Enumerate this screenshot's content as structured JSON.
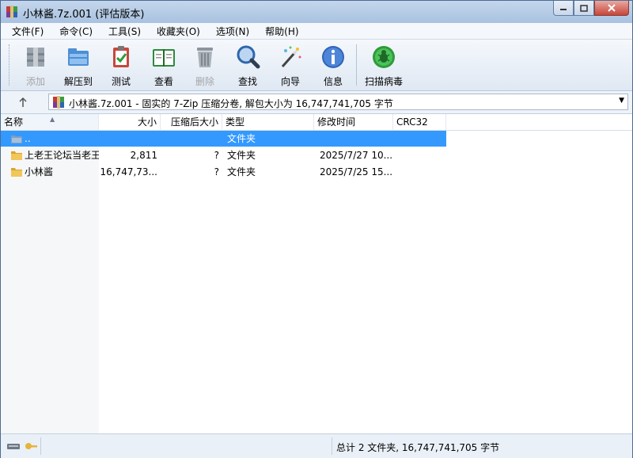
{
  "window": {
    "title": "小林酱.7z.001 (评估版本)"
  },
  "menu": [
    "文件(F)",
    "命令(C)",
    "工具(S)",
    "收藏夹(O)",
    "选项(N)",
    "帮助(H)"
  ],
  "toolbar": {
    "add": "添加",
    "extract": "解压到",
    "test": "测试",
    "view": "查看",
    "delete": "删除",
    "find": "查找",
    "wizard": "向导",
    "info": "信息",
    "scan": "扫描病毒"
  },
  "address": {
    "text": "小林酱.7z.001 - 固实的 7-Zip 压缩分卷, 解包大小为 16,747,741,705 字节"
  },
  "columns": {
    "name": "名称",
    "size": "大小",
    "packed": "压缩后大小",
    "type": "类型",
    "modified": "修改时间",
    "crc": "CRC32"
  },
  "files": [
    {
      "name": "..",
      "size": "",
      "packed": "",
      "type": "文件夹",
      "modified": "",
      "crc": "",
      "icon": "up-folder-icon"
    },
    {
      "name": "上老王论坛当老王",
      "size": "2,811",
      "packed": "?",
      "type": "文件夹",
      "modified": "2025/7/27 10...",
      "crc": "",
      "icon": "folder-icon"
    },
    {
      "name": "小林酱",
      "size": "16,747,73...",
      "packed": "?",
      "type": "文件夹",
      "modified": "2025/7/25 15...",
      "crc": "",
      "icon": "folder-icon"
    }
  ],
  "status": {
    "text": "总计 2 文件夹, 16,747,741,705 字节"
  },
  "colors": {
    "selection": "#3399ff",
    "folder": "#e8b53c"
  }
}
